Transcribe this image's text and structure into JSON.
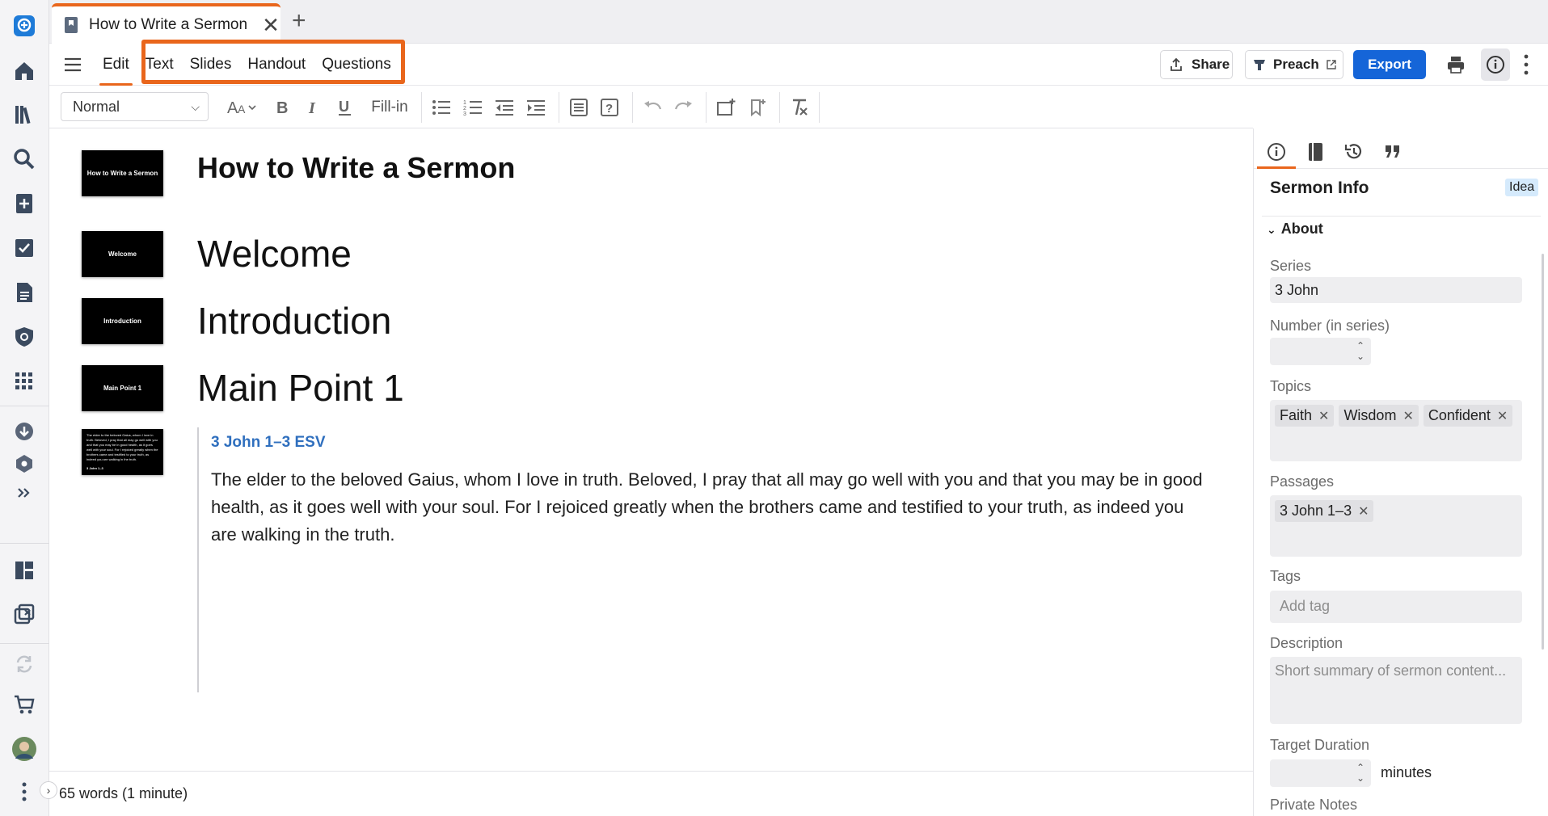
{
  "colors": {
    "accent": "#e9661c",
    "primary": "#1565d8",
    "link": "#2f6fbe",
    "rail_icon": "#3b4a5f"
  },
  "rail": {
    "icons": [
      "app-logo-icon",
      "home-icon",
      "library-icon",
      "search-icon",
      "add-document-icon",
      "checklist-icon",
      "document-icon",
      "shield-icon",
      "apps-grid-icon",
      "download-icon",
      "settings-hex-icon",
      "expand-icon",
      "layout-icon",
      "pop-out-icon",
      "sync-icon",
      "cart-icon",
      "avatar",
      "more-vertical-icon"
    ]
  },
  "tab": {
    "title": "How to Write a Sermon",
    "close": "✕",
    "add": "+"
  },
  "header": {
    "modes": [
      "Edit",
      "Text",
      "Slides",
      "Handout",
      "Questions"
    ],
    "active_mode": "Edit",
    "share_label": "Share",
    "preach_label": "Preach",
    "export_label": "Export"
  },
  "toolbar": {
    "style_value": "Normal",
    "fill_in_label": "Fill-in"
  },
  "document": {
    "title": "How to Write a Sermon",
    "title_thumb": "How to Write a Sermon",
    "sections": [
      {
        "heading": "Welcome",
        "thumb": "Welcome"
      },
      {
        "heading": "Introduction",
        "thumb": "Introduction"
      },
      {
        "heading": "Main Point 1",
        "thumb": "Main Point 1"
      }
    ],
    "passage": {
      "reference": "3 John 1–3 ESV",
      "text": "The elder to the beloved Gaius, whom I love in truth. Beloved, I pray that all may go well with you and that you may be in good health, as it goes well with your soul. For I rejoiced greatly when the brothers came and testified to your truth, as indeed you are walking in the truth.",
      "thumb_ref": "3 John 1–3"
    }
  },
  "status": {
    "word_count": "65 words (1 minute)"
  },
  "info_pane": {
    "title": "Sermon Info",
    "badge": "Idea",
    "section": "About",
    "series_label": "Series",
    "series_value": "3 John",
    "number_label": "Number (in series)",
    "number_value": "",
    "topics_label": "Topics",
    "topics": [
      "Faith",
      "Wisdom",
      "Confident"
    ],
    "passages_label": "Passages",
    "passages": [
      "3 John 1–3"
    ],
    "tags_label": "Tags",
    "tags_placeholder": "Add tag",
    "description_label": "Description",
    "description_placeholder": "Short summary of sermon content...",
    "duration_label": "Target Duration",
    "duration_unit": "minutes",
    "notes_label": "Private Notes"
  }
}
